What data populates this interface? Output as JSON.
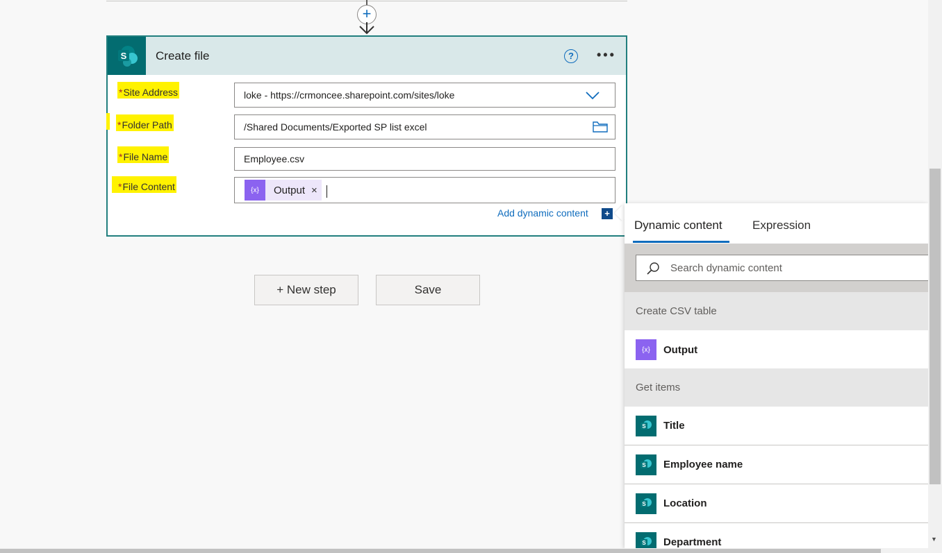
{
  "connector": {
    "insert_label": "+"
  },
  "card": {
    "title": "Create file",
    "help_label": "?",
    "more_label": "•••",
    "fields": [
      {
        "label": "Site Address",
        "value": "loke - https://crmoncee.sharepoint.com/sites/loke"
      },
      {
        "label": "Folder Path",
        "value": "/Shared Documents/Exported SP list excel"
      },
      {
        "label": "File Name",
        "value": "Employee.csv"
      },
      {
        "label": "File Content",
        "token": "Output"
      }
    ],
    "required_mark": "*",
    "token_icon": "{x}",
    "token_close": "×",
    "add_dynamic_label": "Add dynamic content",
    "add_dynamic_icon": "+"
  },
  "actions": {
    "new_step": "+ New step",
    "save": "Save"
  },
  "panel": {
    "tabs": [
      "Dynamic content",
      "Expression"
    ],
    "active_tab": "Dynamic content",
    "search_placeholder": "Search dynamic content",
    "sections": [
      {
        "title": "Create CSV table",
        "items": [
          {
            "label": "Output",
            "icon": "variable-icon"
          }
        ]
      },
      {
        "title": "Get items",
        "items": [
          {
            "label": "Title",
            "icon": "sharepoint-icon"
          },
          {
            "label": "Employee name",
            "icon": "sharepoint-icon"
          },
          {
            "label": "Location",
            "icon": "sharepoint-icon"
          },
          {
            "label": "Department",
            "icon": "sharepoint-icon"
          }
        ]
      }
    ]
  },
  "colors": {
    "accent": "#0f6cbd",
    "sharepoint": "#036c70",
    "variable": "#8b63f0",
    "highlight": "#fff200",
    "card_border": "#217f7e"
  }
}
